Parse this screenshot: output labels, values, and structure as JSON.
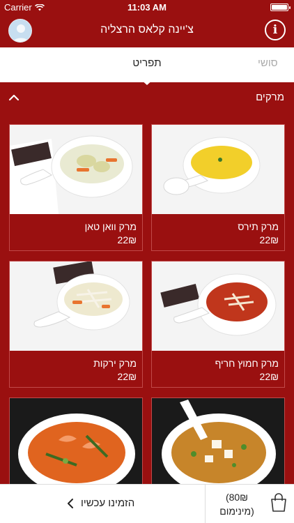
{
  "status_bar": {
    "carrier": "Carrier",
    "time": "11:03 AM"
  },
  "header": {
    "title": "צ'יינה קלאס הרצליה",
    "info_glyph": "i"
  },
  "tabs": {
    "active": "תפריט",
    "other": "סושי"
  },
  "section": {
    "label": "מרקים"
  },
  "items": [
    {
      "name": "מרק תירס",
      "price": "22₪"
    },
    {
      "name": "מרק וואן טאן",
      "price": "22₪"
    },
    {
      "name": "מרק חמוץ חריף",
      "price": "22₪"
    },
    {
      "name": "מרק ירקות",
      "price": "22₪"
    }
  ],
  "bottom_bar": {
    "order_label": "הזמינו עכשיו",
    "minimum_amount": "(80₪",
    "minimum_label": "מינימום)"
  },
  "colors": {
    "brand": "#9a1010",
    "white": "#ffffff"
  },
  "icons": [
    "wifi-icon",
    "battery-icon",
    "user-avatar-icon",
    "info-icon",
    "chevron-up-icon",
    "chevron-left-icon",
    "shopping-bag-icon"
  ]
}
